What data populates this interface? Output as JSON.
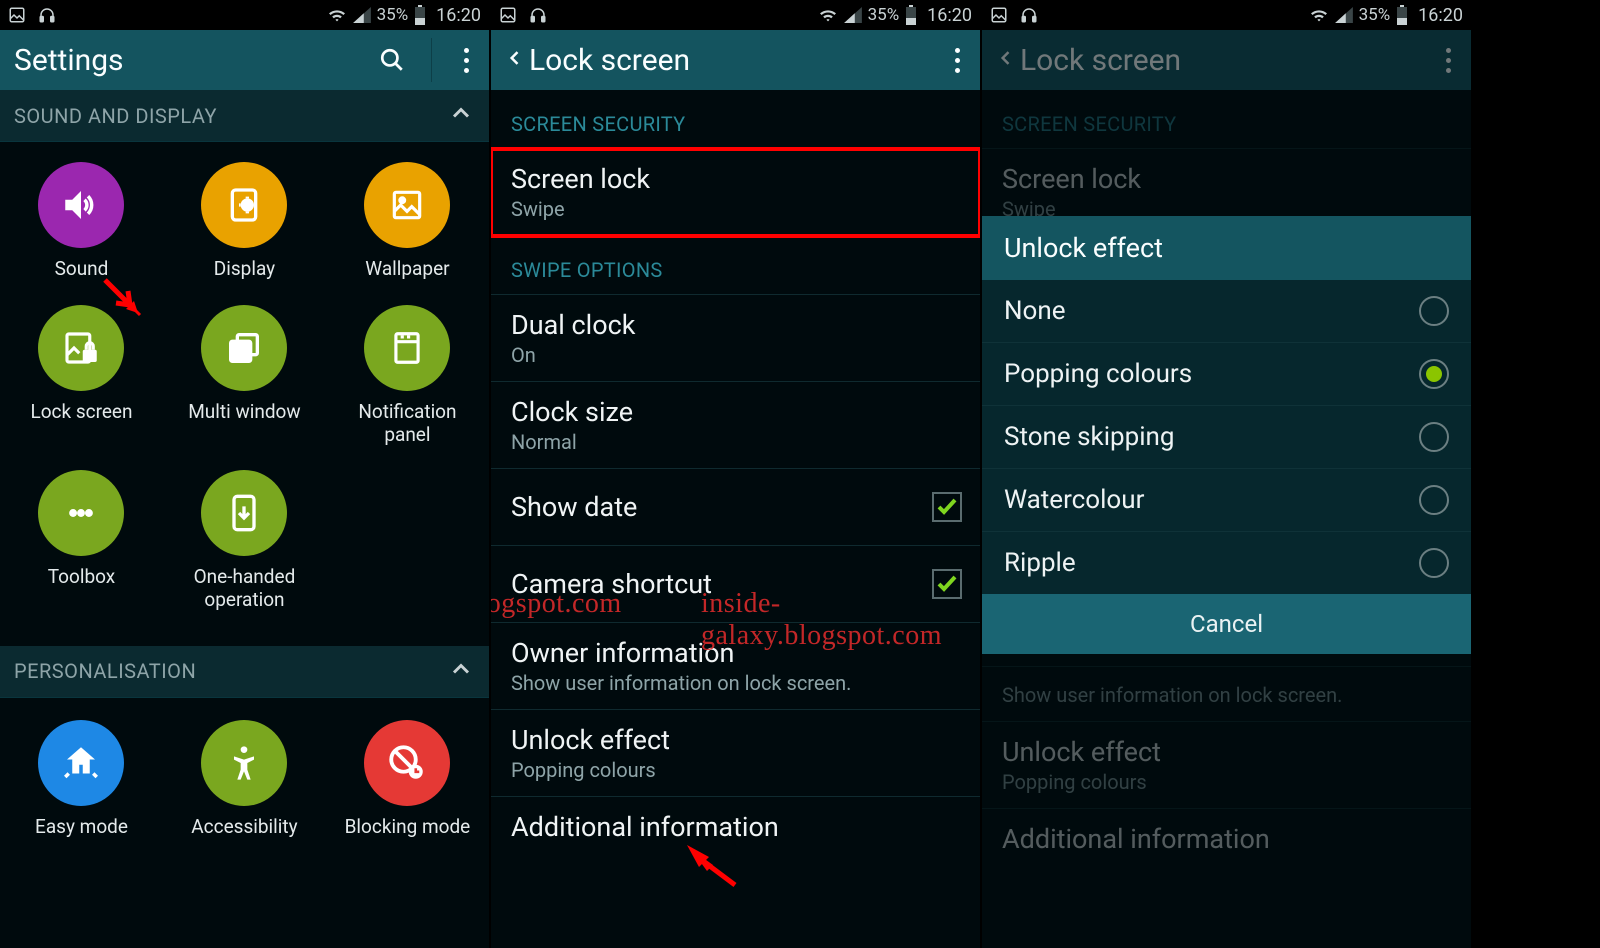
{
  "status": {
    "battery_pct": "35%",
    "time": "16:20"
  },
  "watermark": "inside-galaxy.blogspot.com",
  "panel1": {
    "title": "Settings",
    "section1": "SOUND AND DISPLAY",
    "section2": "PERSONALISATION",
    "cells": {
      "sound": "Sound",
      "display": "Display",
      "wallpaper": "Wallpaper",
      "lockscreen": "Lock screen",
      "multiwindow": "Multi window",
      "notif": "Notification panel",
      "toolbox": "Toolbox",
      "onehand": "One-handed operation",
      "easymode": "Easy mode",
      "accessibility": "Accessibility",
      "blockingmode": "Blocking mode"
    }
  },
  "panel2": {
    "title": "Lock screen",
    "cat1": "SCREEN SECURITY",
    "cat2": "SWIPE OPTIONS",
    "items": {
      "screenlock_t": "Screen lock",
      "screenlock_s": "Swipe",
      "dualclock_t": "Dual clock",
      "dualclock_s": "On",
      "clocksize_t": "Clock size",
      "clocksize_s": "Normal",
      "showdate_t": "Show date",
      "camshort_t": "Camera shortcut",
      "owner_t": "Owner information",
      "owner_s": "Show user information on lock screen.",
      "unlock_t": "Unlock effect",
      "unlock_s": "Popping colours",
      "addl_t": "Additional information"
    }
  },
  "panel3": {
    "title": "Lock screen",
    "cat1": "SCREEN SECURITY",
    "screenlock_t": "Screen lock",
    "screenlock_s": "Swipe",
    "owner_s": "Show user information on lock screen.",
    "unlock_t": "Unlock effect",
    "unlock_s": "Popping colours",
    "addl_t": "Additional information",
    "dialog": {
      "title": "Unlock effect",
      "opts": {
        "none": "None",
        "popping": "Popping colours",
        "stone": "Stone skipping",
        "water": "Watercolour",
        "ripple": "Ripple"
      },
      "cancel": "Cancel"
    }
  }
}
